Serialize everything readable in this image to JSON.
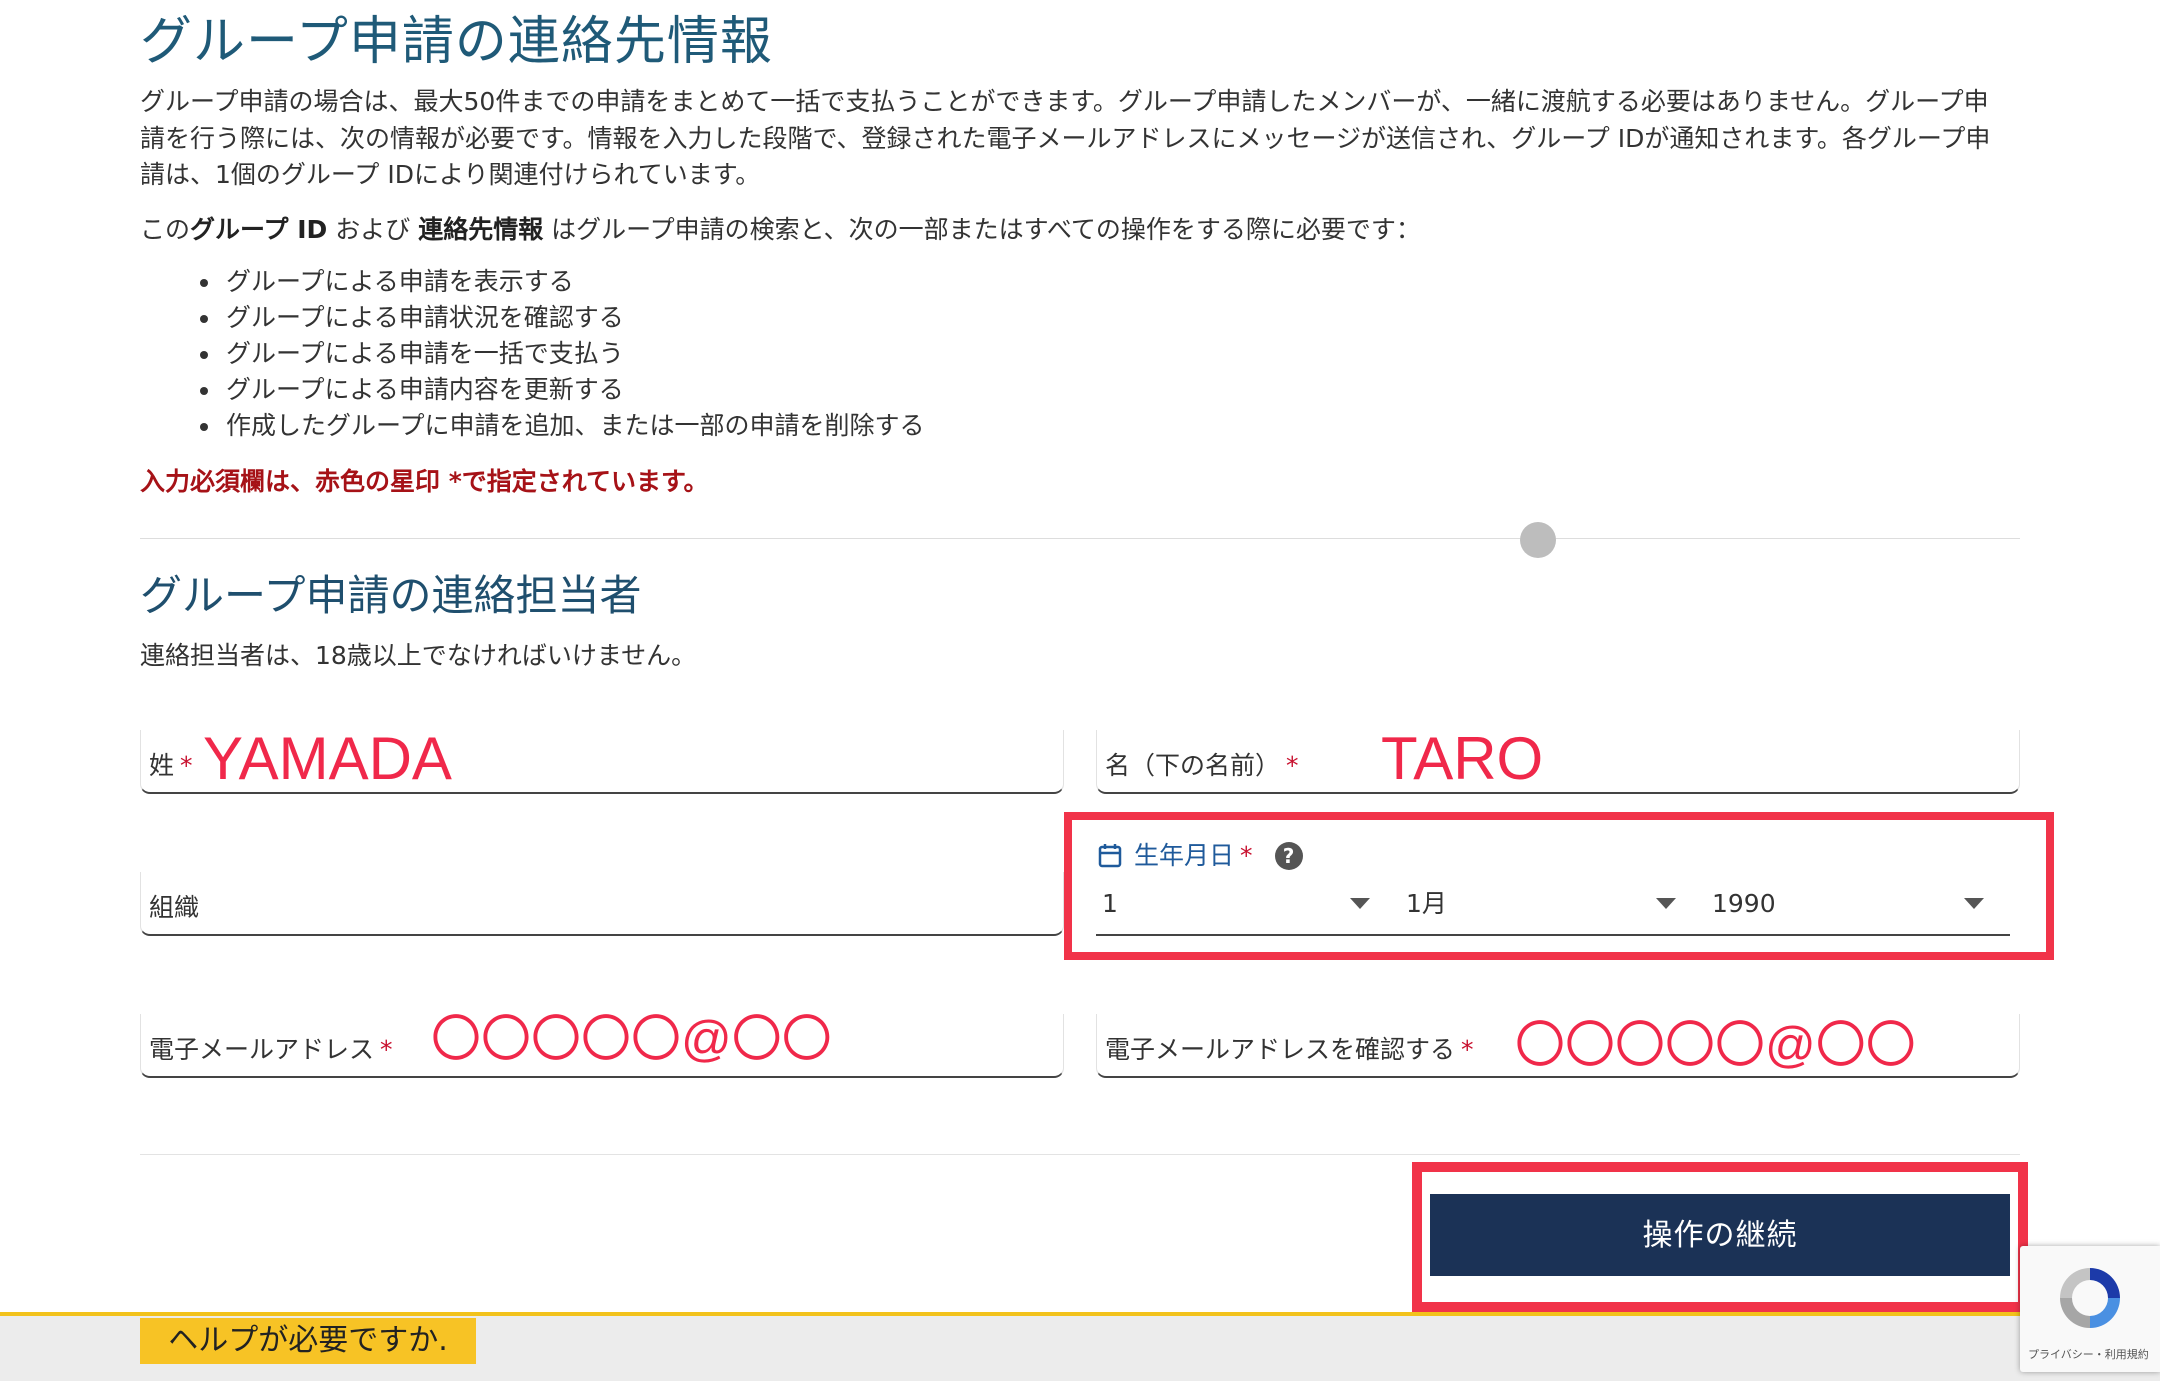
{
  "header": {
    "title": "グループ申請の連絡先情報"
  },
  "intro": {
    "paragraph": "グループ申請の場合は、最大50件までの申請をまとめて一括で支払うことができます。グループ申請したメンバーが、一緒に渡航する必要はありません。グループ申請を行う際には、次の情報が必要です。情報を入力した段階で、登録された電子メールアドレスにメッセージが送信され、グループ IDが通知されます。各グループ申請は、1個のグループ IDにより関連付けられています。",
    "ids_prefix": "この",
    "ids_group_id": "グループ ID",
    "ids_and": " および ",
    "ids_contact": "連絡先情報",
    "ids_suffix": " はグループ申請の検索と、次の一部またはすべての操作をする際に必要です：",
    "operations": [
      "グループによる申請を表示する",
      "グループによる申請状況を確認する",
      "グループによる申請を一括で支払う",
      "グループによる申請内容を更新する",
      "作成したグループに申請を追加、または一部の申請を削除する"
    ],
    "required_note": "入力必須欄は、赤色の星印 *で指定されています。"
  },
  "contact_section": {
    "title": "グループ申請の連絡担当者",
    "subtitle": "連絡担当者は、18歳以上でなければいけません。"
  },
  "form": {
    "star": "*",
    "last_name": {
      "label": "姓",
      "value": "YAMADA"
    },
    "first_name": {
      "label": "名（下の名前）",
      "value": "TARO"
    },
    "organization": {
      "label": "組織"
    },
    "dob": {
      "label": "生年月日",
      "help": "?",
      "day": "1",
      "month": "1月",
      "year": "1990"
    },
    "email": {
      "label": "電子メールアドレス",
      "value": "〇〇〇〇〇@〇〇"
    },
    "email_confirm": {
      "label": "電子メールアドレスを確認する",
      "value": "〇〇〇〇〇@〇〇"
    }
  },
  "actions": {
    "continue_label": "操作の継続"
  },
  "footer": {
    "help_label": "ヘルプが必要ですか."
  },
  "recaptcha": {
    "links": "プライバシー・利用規約"
  },
  "colors": {
    "title_blue": "#1f5a78",
    "required_red": "#a61217",
    "annotation_red": "#f13349",
    "button_navy": "#1b3256",
    "help_yellow": "#f7c325"
  }
}
